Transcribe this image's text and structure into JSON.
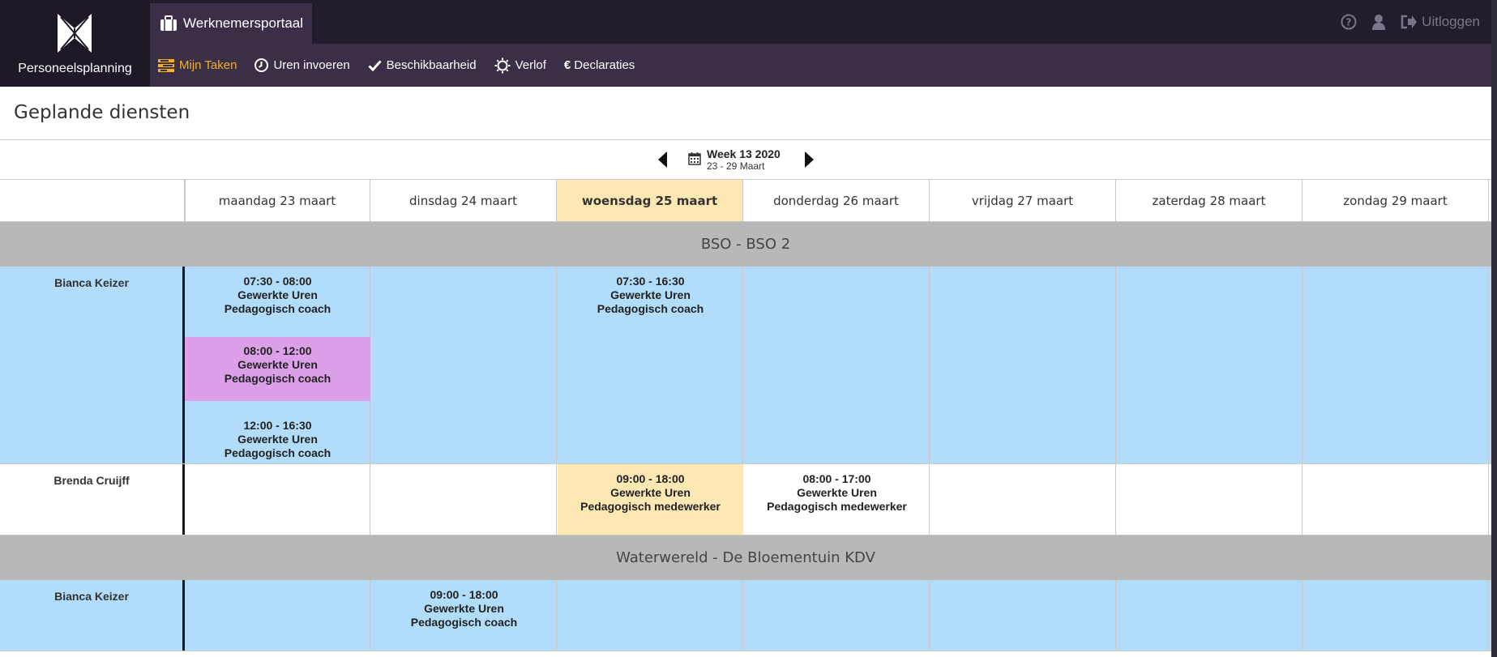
{
  "brand": {
    "name": "Personeelsplanning"
  },
  "header": {
    "portal_tab": "Werknemersportaal",
    "logout_label": "Uitloggen"
  },
  "nav": {
    "items": [
      {
        "label": "Mijn Taken",
        "icon": "tasks-icon"
      },
      {
        "label": "Uren invoeren",
        "icon": "clock-icon"
      },
      {
        "label": "Beschikbaarheid",
        "icon": "check-icon"
      },
      {
        "label": "Verlof",
        "icon": "sun-icon"
      },
      {
        "label": "Declaraties",
        "icon": "euro-icon"
      }
    ]
  },
  "page": {
    "title": "Geplande diensten"
  },
  "week": {
    "title": "Week 13 2020",
    "range": "23 - 29 Maart"
  },
  "days": [
    "maandag 23 maart",
    "dinsdag 24 maart",
    "woensdag 25 maart",
    "donderdag 26 maart",
    "vrijdag 27 maart",
    "zaterdag 28 maart",
    "zondag 29 maart"
  ],
  "groups": [
    {
      "name": "BSO - BSO 2",
      "people": [
        {
          "name": "Bianca Keizer",
          "shifts": [
            {
              "day": 0,
              "time": "07:30 - 08:00",
              "type": "Gewerkte Uren",
              "role": "Pedagogisch coach"
            },
            {
              "day": 0,
              "time": "08:00 - 12:00",
              "type": "Gewerkte Uren",
              "role": "Pedagogisch coach",
              "color": "#dca0e8"
            },
            {
              "day": 0,
              "time": "12:00 - 16:30",
              "type": "Gewerkte Uren",
              "role": "Pedagogisch coach"
            },
            {
              "day": 2,
              "time": "07:30 - 16:30",
              "type": "Gewerkte Uren",
              "role": "Pedagogisch coach"
            }
          ]
        },
        {
          "name": "Brenda Cruijff",
          "shifts": [
            {
              "day": 2,
              "time": "09:00 - 18:00",
              "type": "Gewerkte Uren",
              "role": "Pedagogisch medewerker"
            },
            {
              "day": 3,
              "time": "08:00 - 17:00",
              "type": "Gewerkte Uren",
              "role": "Pedagogisch medewerker"
            }
          ]
        }
      ]
    },
    {
      "name": "Waterwereld - De Bloementuin KDV",
      "people": [
        {
          "name": "Bianca Keizer",
          "shifts": [
            {
              "day": 1,
              "time": "09:00 - 18:00",
              "type": "Gewerkte Uren",
              "role": "Pedagogisch coach"
            }
          ]
        }
      ]
    }
  ],
  "colors": {
    "header_dark": "#221c2c",
    "header_nav": "#3a2f47",
    "accent": "#f3b21b",
    "today": "#fde8b4",
    "row_blue": "#b1dcfa",
    "group_gray": "#b8b8b8",
    "shift_highlight": "#dca0e8"
  }
}
